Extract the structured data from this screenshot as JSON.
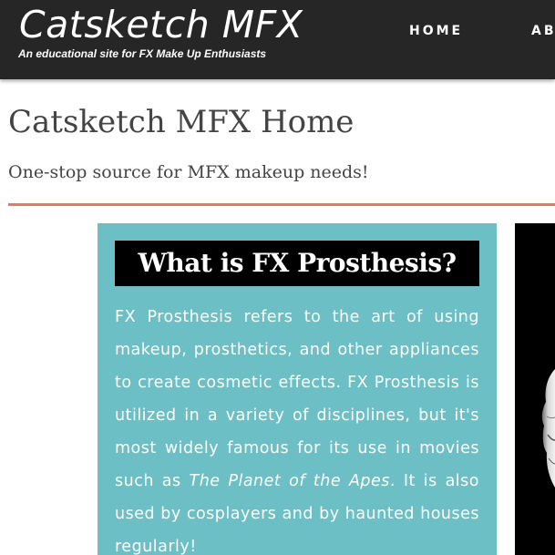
{
  "header": {
    "site_title": "Catsketch MFX",
    "tagline": "An educational site for FX Make Up Enthusiasts",
    "nav": [
      {
        "label": "HOME"
      },
      {
        "label": "AB"
      }
    ]
  },
  "main": {
    "title": "Catsketch MFX Home",
    "subtitle": "One-stop source for MFX makeup needs!",
    "panel": {
      "heading": "What is FX Prosthesis?",
      "text_before": "FX Prosthesis refers to the art of using makeup, prosthetics, and other appliances to create cosmetic effects. FX Prosthesis is utilized in a variety of disciplines, but it's most widely famous for its use in movies such as ",
      "text_italic": "The Planet of the Apes",
      "text_after": ". It is also used by cosplayers and by haunted houses regularly!"
    },
    "side_image": {
      "icon": "prosthetic-face-image"
    }
  },
  "colors": {
    "header_bg": "#262626",
    "divider": "#e8776a",
    "panel_bg": "#6cbfc4",
    "heading_bg": "#000000",
    "text_dark": "#444444"
  }
}
